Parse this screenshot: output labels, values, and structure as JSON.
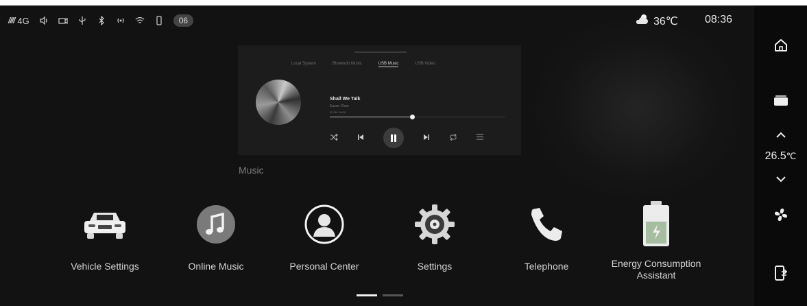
{
  "status_bar": {
    "signal": "////",
    "network": "4G",
    "badge": "06",
    "weather_temp": "36℃",
    "time": "08:36"
  },
  "music_card": {
    "tabs": [
      "Local System",
      "Bluetooth Music",
      "USB Music",
      "USB Video"
    ],
    "active_tab_index": 2,
    "song_title": "Shall We Talk",
    "artist": "Eason Chan",
    "elapsed_total": "02:38 / 04:30",
    "progress": 0.47,
    "card_label": "Music"
  },
  "apps": [
    {
      "label": "Vehicle Settings",
      "icon": "car-icon"
    },
    {
      "label": "Online Music",
      "icon": "music-note-icon"
    },
    {
      "label": "Personal Center",
      "icon": "person-icon"
    },
    {
      "label": "Settings",
      "icon": "gear-icon"
    },
    {
      "label": "Telephone",
      "icon": "phone-icon"
    },
    {
      "label": "Energy Consumption Assistant",
      "icon": "battery-icon"
    }
  ],
  "right_bar": {
    "temperature": "26.5",
    "temp_unit": "℃"
  },
  "pager": {
    "pages": 2,
    "active": 0
  },
  "colors": {
    "background": "#121212",
    "accent": "#f0f0f0",
    "battery_green": "#9fb99a"
  }
}
